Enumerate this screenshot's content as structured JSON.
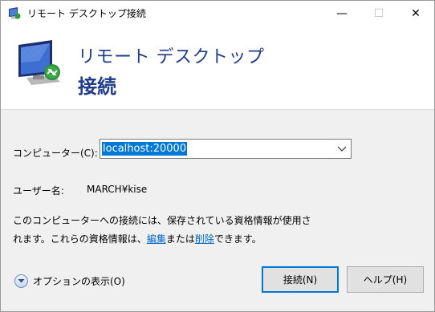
{
  "window": {
    "title": "リモート デスクトップ接続",
    "minimize_glyph": "—",
    "maximize_glyph": "☐",
    "close_glyph": "✕"
  },
  "banner": {
    "line1": "リモート デスクトップ",
    "line2": "接続"
  },
  "form": {
    "computer_label": "コンピューター(C):",
    "computer_value": "localhost:20000",
    "user_label": "ユーザー名:",
    "user_value": "MARCH¥kise",
    "info_line1": "このコンピューターへの接続には、保存されている資格情報が使用さ",
    "info_line2_prefix": "れます。これらの資格情報は、",
    "edit_link": "編集",
    "info_mid": "または",
    "delete_link": "削除",
    "info_suffix": "できます。"
  },
  "options": {
    "label": "オプションの表示(O)"
  },
  "buttons": {
    "connect": "接続(N)",
    "help": "ヘルプ(H)"
  },
  "colors": {
    "banner_text": "#1f3b8a",
    "selection": "#0078d7",
    "link": "#0066cc"
  },
  "icons": {
    "app": "remote-desktop-icon",
    "combo": "chevron-down-icon",
    "options": "expand-circle-icon"
  }
}
